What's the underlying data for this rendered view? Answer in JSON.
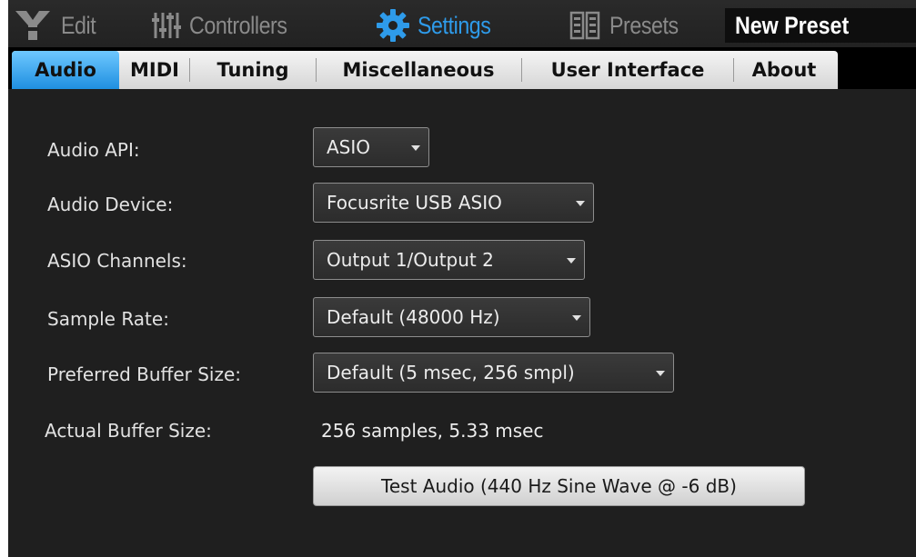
{
  "toolbar": {
    "edit": {
      "label": "Edit",
      "icon": "y-logo-icon"
    },
    "controllers": {
      "label": "Controllers",
      "icon": "sliders-icon"
    },
    "settings": {
      "label": "Settings",
      "icon": "gear-icon",
      "color": "#2e9bea"
    },
    "presets": {
      "label": "Presets",
      "icon": "presets-icon"
    },
    "preset_name": "New Preset"
  },
  "tabs": [
    {
      "label": "Audio",
      "active": true
    },
    {
      "label": "MIDI"
    },
    {
      "label": "Tuning"
    },
    {
      "label": "Miscellaneous"
    },
    {
      "label": "User Interface"
    },
    {
      "label": "About"
    }
  ],
  "audio": {
    "audio_api": {
      "label": "Audio API:",
      "value": "ASIO"
    },
    "audio_device": {
      "label": "Audio Device:",
      "value": "Focusrite USB ASIO"
    },
    "asio_channels": {
      "label": "ASIO Channels:",
      "value": "Output 1/Output 2"
    },
    "sample_rate": {
      "label": "Sample Rate:",
      "value": "Default (48000 Hz)"
    },
    "preferred_buffer": {
      "label": "Preferred Buffer Size:",
      "value": "Default (5 msec, 256 smpl)"
    },
    "actual_buffer": {
      "label": "Actual Buffer Size:",
      "value": "256 samples, 5.33 msec"
    },
    "test_button": "Test Audio (440 Hz Sine Wave @ -6 dB)"
  },
  "colors": {
    "accent": "#2e9bea",
    "active_tab": "#3aa6f0",
    "background": "#1f1f1f"
  }
}
